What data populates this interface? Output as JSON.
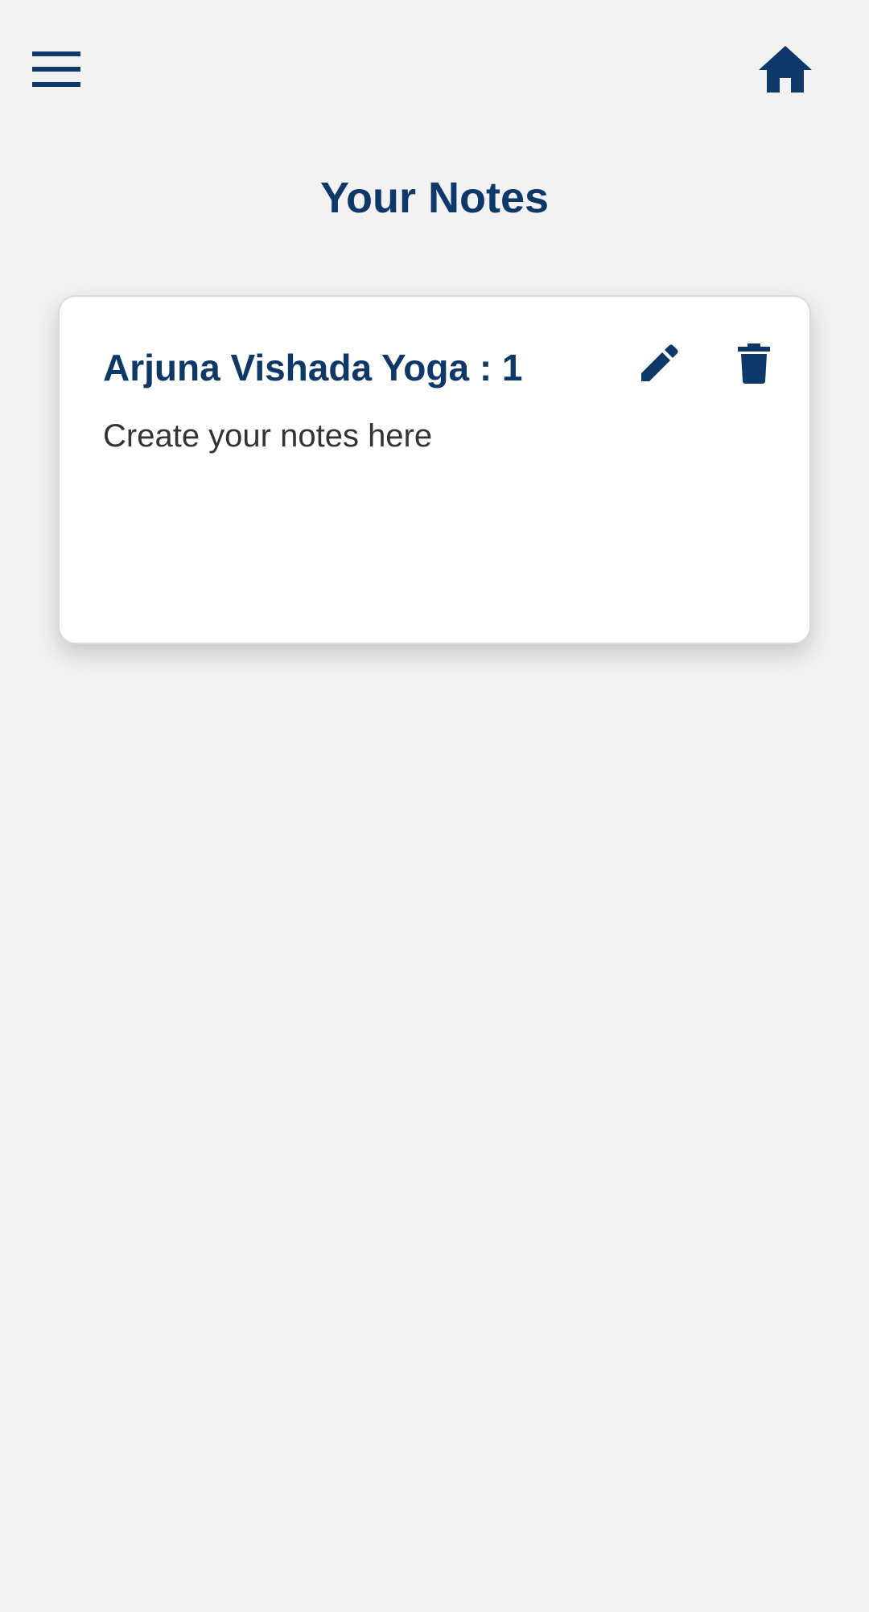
{
  "app": {
    "page_title": "Your Notes"
  },
  "header": {
    "menu_icon": "hamburger-menu-icon",
    "home_icon": "home-icon"
  },
  "notes": [
    {
      "title": "Arjuna Vishada Yoga : 1",
      "body": "Create your notes here",
      "edit_icon": "pencil-icon",
      "delete_icon": "trash-icon"
    }
  ],
  "colors": {
    "primary": "#0d3868",
    "background": "#f2f2f3",
    "card": "#ffffff",
    "body_text": "#333333"
  }
}
